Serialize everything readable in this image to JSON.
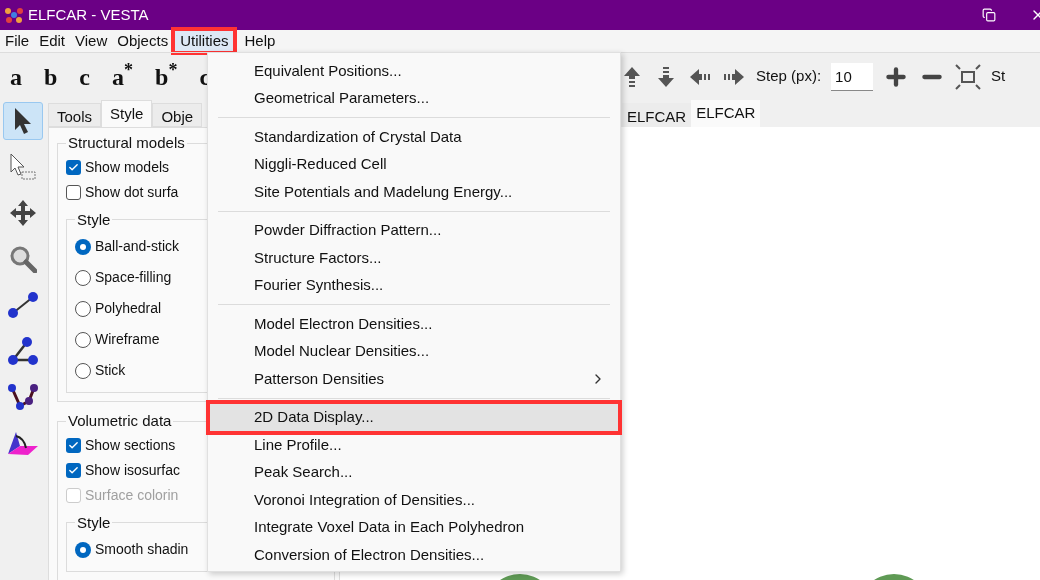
{
  "window": {
    "title": "ELFCAR - VESTA"
  },
  "menubar": [
    {
      "label": "File",
      "selected": false,
      "annotated": false
    },
    {
      "label": "Edit",
      "selected": false,
      "annotated": false
    },
    {
      "label": "View",
      "selected": false,
      "annotated": false
    },
    {
      "label": "Objects",
      "selected": false,
      "annotated": false
    },
    {
      "label": "Utilities",
      "selected": true,
      "annotated": true
    },
    {
      "label": "Help",
      "selected": false,
      "annotated": false
    }
  ],
  "axis_buttons": [
    "a",
    "b",
    "c",
    "a$^{*}$",
    "b$^{*}$",
    "c"
  ],
  "toolbar": {
    "step_label": "Step (px):",
    "step_value": "10",
    "cut_label": "St"
  },
  "tools": [
    {
      "kind": "select",
      "selected": true
    },
    {
      "kind": "select-box",
      "selected": false
    },
    {
      "kind": "move",
      "selected": false
    },
    {
      "kind": "zoom",
      "selected": false
    },
    {
      "kind": "distance",
      "selected": false
    },
    {
      "kind": "angle",
      "selected": false
    },
    {
      "kind": "dihedral",
      "selected": false
    },
    {
      "kind": "plane",
      "selected": false
    }
  ],
  "panel_tabs": [
    {
      "label": "Tools",
      "selected": false
    },
    {
      "label": "Style",
      "selected": true
    },
    {
      "label": "Obje",
      "selected": false
    }
  ],
  "groups": [
    {
      "title": "Structural models",
      "checks": [
        {
          "label": "Show models",
          "checked": true,
          "disabled": false
        },
        {
          "label": "Show dot surfa",
          "checked": false,
          "disabled": false
        }
      ],
      "style_title": "Style",
      "radios": [
        {
          "label": "Ball-and-stick",
          "selected": true
        },
        {
          "label": "Space-filling",
          "selected": false
        },
        {
          "label": "Polyhedral",
          "selected": false
        },
        {
          "label": "Wireframe",
          "selected": false
        },
        {
          "label": "Stick",
          "selected": false
        }
      ]
    },
    {
      "title": "Volumetric data",
      "checks": [
        {
          "label": "Show sections",
          "checked": true,
          "disabled": false
        },
        {
          "label": "Show isosurfac",
          "checked": true,
          "disabled": false
        },
        {
          "label": "Surface colorin",
          "checked": false,
          "disabled": true
        }
      ],
      "style_title": "Style",
      "radios": [
        {
          "label": "Smooth shadin",
          "selected": true
        }
      ]
    }
  ],
  "view_tabs": [
    {
      "label": "ELFCAR",
      "selected": false
    },
    {
      "label": "ELFCAR",
      "selected": true
    }
  ],
  "utilities_menu": [
    [
      {
        "label": "Equivalent Positions...",
        "submenu": false,
        "selected": false,
        "annotated": false
      },
      {
        "label": "Geometrical Parameters...",
        "submenu": false,
        "selected": false,
        "annotated": false
      }
    ],
    [
      {
        "label": "Standardization of Crystal Data",
        "submenu": false,
        "selected": false,
        "annotated": false
      },
      {
        "label": "Niggli-Reduced Cell",
        "submenu": false,
        "selected": false,
        "annotated": false
      },
      {
        "label": "Site Potentials and Madelung Energy...",
        "submenu": false,
        "selected": false,
        "annotated": false
      }
    ],
    [
      {
        "label": "Powder Diffraction Pattern...",
        "submenu": false,
        "selected": false,
        "annotated": false
      },
      {
        "label": "Structure Factors...",
        "submenu": false,
        "selected": false,
        "annotated": false
      },
      {
        "label": "Fourier Synthesis...",
        "submenu": false,
        "selected": false,
        "annotated": false
      }
    ],
    [
      {
        "label": "Model Electron Densities...",
        "submenu": false,
        "selected": false,
        "annotated": false
      },
      {
        "label": "Model Nuclear Densities...",
        "submenu": false,
        "selected": false,
        "annotated": false
      },
      {
        "label": "Patterson Densities",
        "submenu": true,
        "selected": false,
        "annotated": false
      }
    ],
    [
      {
        "label": "2D Data Display...",
        "submenu": false,
        "selected": true,
        "annotated": true
      },
      {
        "label": "Line Profile...",
        "submenu": false,
        "selected": false,
        "annotated": false
      },
      {
        "label": "Peak Search...",
        "submenu": false,
        "selected": false,
        "annotated": false
      },
      {
        "label": "Voronoi Integration of Densities...",
        "submenu": false,
        "selected": false,
        "annotated": false
      },
      {
        "label": "Integrate Voxel Data in Each Polyhedron",
        "submenu": false,
        "selected": false,
        "annotated": false
      },
      {
        "label": "Conversion of Electron Densities...",
        "submenu": false,
        "selected": false,
        "annotated": false
      }
    ]
  ]
}
